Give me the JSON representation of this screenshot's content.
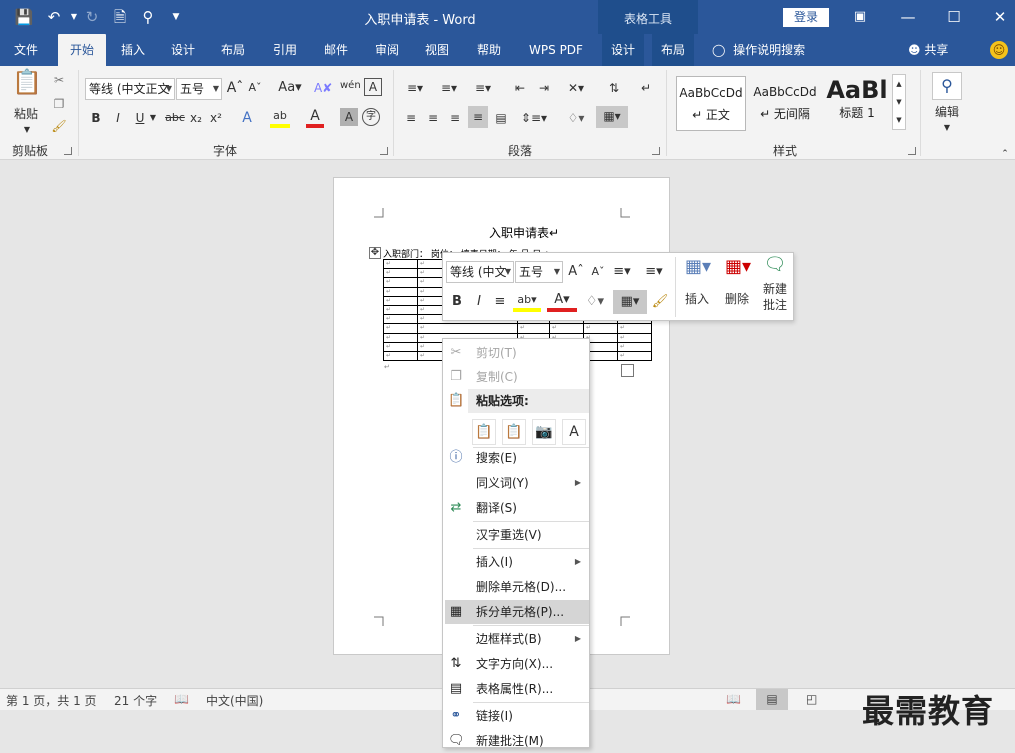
{
  "window": {
    "title": "入职申请表 - Word",
    "context_tab": "表格工具",
    "login": "登录"
  },
  "tabs": [
    "文件",
    "开始",
    "插入",
    "设计",
    "布局",
    "引用",
    "邮件",
    "审阅",
    "视图",
    "帮助",
    "WPS PDF",
    "设计",
    "布局"
  ],
  "tell_me": "操作说明搜索",
  "share": "共享",
  "ribbon": {
    "clipboard": {
      "paste": "粘贴",
      "label": "剪贴板"
    },
    "font": {
      "name": "等线 (中文正文",
      "size": "五号",
      "label": "字体",
      "bold": "B",
      "italic": "I",
      "underline": "U",
      "strike": "abc",
      "sub": "x₂",
      "sup": "x²"
    },
    "paragraph": {
      "label": "段落"
    },
    "styles": {
      "items": [
        {
          "sample": "AaBbCcDd",
          "name": "↵ 正文"
        },
        {
          "sample": "AaBbCcDd",
          "name": "↵ 无间隔"
        },
        {
          "sample": "AaBl",
          "name": "标题 1"
        }
      ],
      "label": "样式"
    },
    "editing": {
      "label": "编辑"
    }
  },
  "document": {
    "title": "入职申请表↵",
    "header_row": "入职部门：    岗位：    填表日期：    年    月    日↵",
    "rows": 11,
    "cols": 7,
    "cell_mark": "↵"
  },
  "minitoolbar": {
    "font": "等线 (中文",
    "size": "五号",
    "insert": "插入",
    "delete": "删除",
    "new_comment_1": "新建",
    "new_comment_2": "批注",
    "bold": "B",
    "italic": "I"
  },
  "contextmenu": {
    "cut": "剪切(T)",
    "copy": "复制(C)",
    "paste_header": "粘贴选项:",
    "search": "搜索(E)",
    "synonym": "同义词(Y)",
    "translate": "翻译(S)",
    "reconvert": "汉字重选(V)",
    "insert": "插入(I)",
    "delete_cells": "删除单元格(D)...",
    "split_cells": "拆分单元格(P)...",
    "border_style": "边框样式(B)",
    "text_direction": "文字方向(X)...",
    "table_props": "表格属性(R)...",
    "link": "链接(I)",
    "new_comment": "新建批注(M)"
  },
  "statusbar": {
    "page": "第 1 页，共 1 页",
    "words": "21 个字",
    "lang": "中文(中国)"
  },
  "watermark": "最需教育",
  "colors": {
    "brand": "#2b579a",
    "ribbon": "#f3f3f3",
    "highlight": "#ffff00",
    "font_red": "#e02020"
  }
}
